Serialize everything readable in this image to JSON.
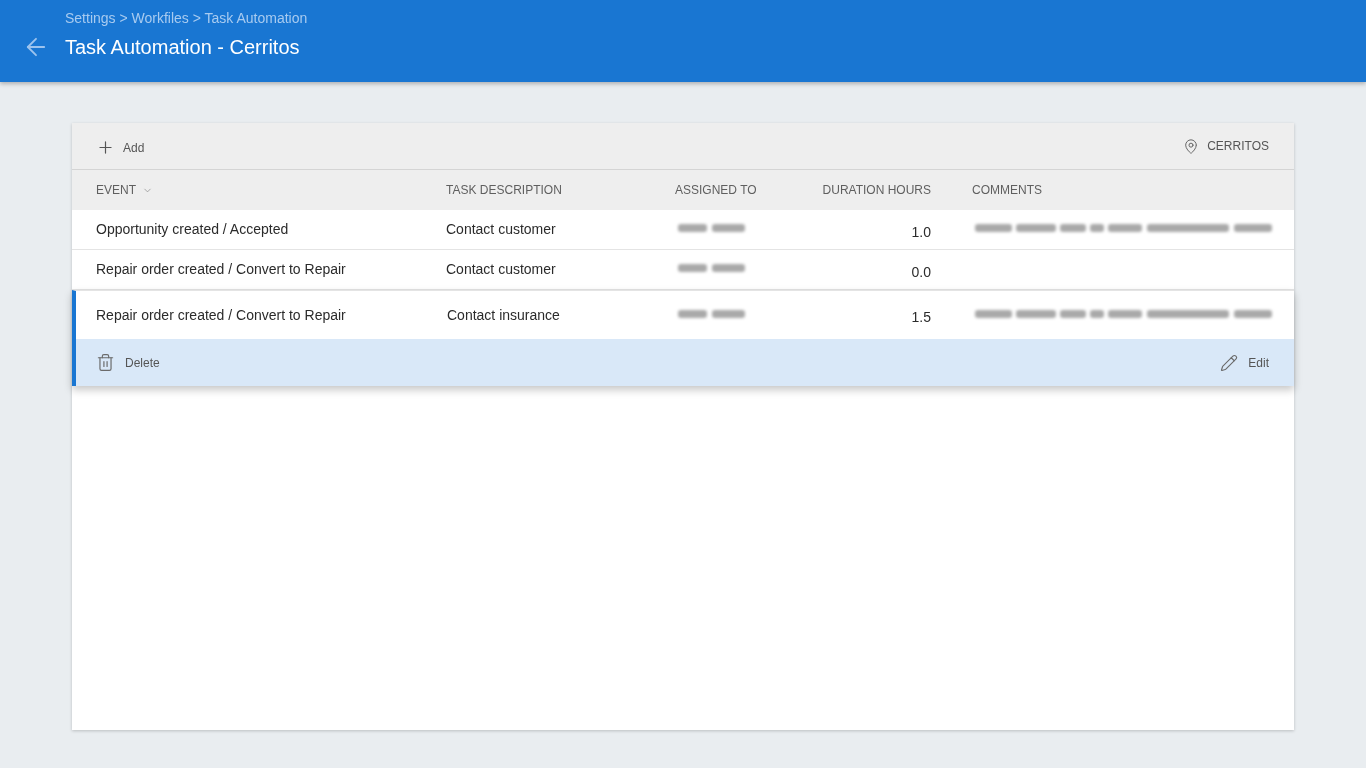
{
  "header": {
    "breadcrumb": "Settings > Workfiles > Task Automation",
    "title": "Task Automation - Cerritos"
  },
  "toolbar": {
    "add_label": "Add",
    "location": "CERRITOS"
  },
  "table": {
    "columns": [
      {
        "label": "EVENT",
        "sorted": true
      },
      {
        "label": "TASK DESCRIPTION",
        "sorted": false
      },
      {
        "label": "ASSIGNED TO",
        "sorted": false
      },
      {
        "label": "DURATION HOURS",
        "sorted": false
      },
      {
        "label": "COMMENTS",
        "sorted": false
      }
    ],
    "rows": [
      {
        "selected": false,
        "cells": [
          {
            "kind": "text",
            "text": "Opportunity created / Accepted"
          },
          {
            "kind": "text",
            "text": "Contact customer"
          },
          {
            "kind": "blurred"
          },
          {
            "kind": "text",
            "text": "1.0"
          },
          {
            "kind": "blurred"
          }
        ]
      },
      {
        "selected": false,
        "cells": [
          {
            "kind": "text",
            "text": "Repair order created / Convert to Repair"
          },
          {
            "kind": "text",
            "text": "Contact customer"
          },
          {
            "kind": "blurred"
          },
          {
            "kind": "text",
            "text": "0.0"
          }
        ]
      },
      {
        "selected": true,
        "cells": [
          {
            "kind": "text",
            "text": "Repair order created / Convert to Repair"
          },
          {
            "kind": "text",
            "text": "Contact insurance"
          },
          {
            "kind": "blurred"
          },
          {
            "kind": "text",
            "text": "1.5"
          },
          {
            "kind": "blurred"
          }
        ]
      }
    ],
    "row_actions": [
      {
        "kind": "delete",
        "label": "Delete"
      },
      {
        "kind": "edit",
        "label": "Edit"
      }
    ]
  }
}
